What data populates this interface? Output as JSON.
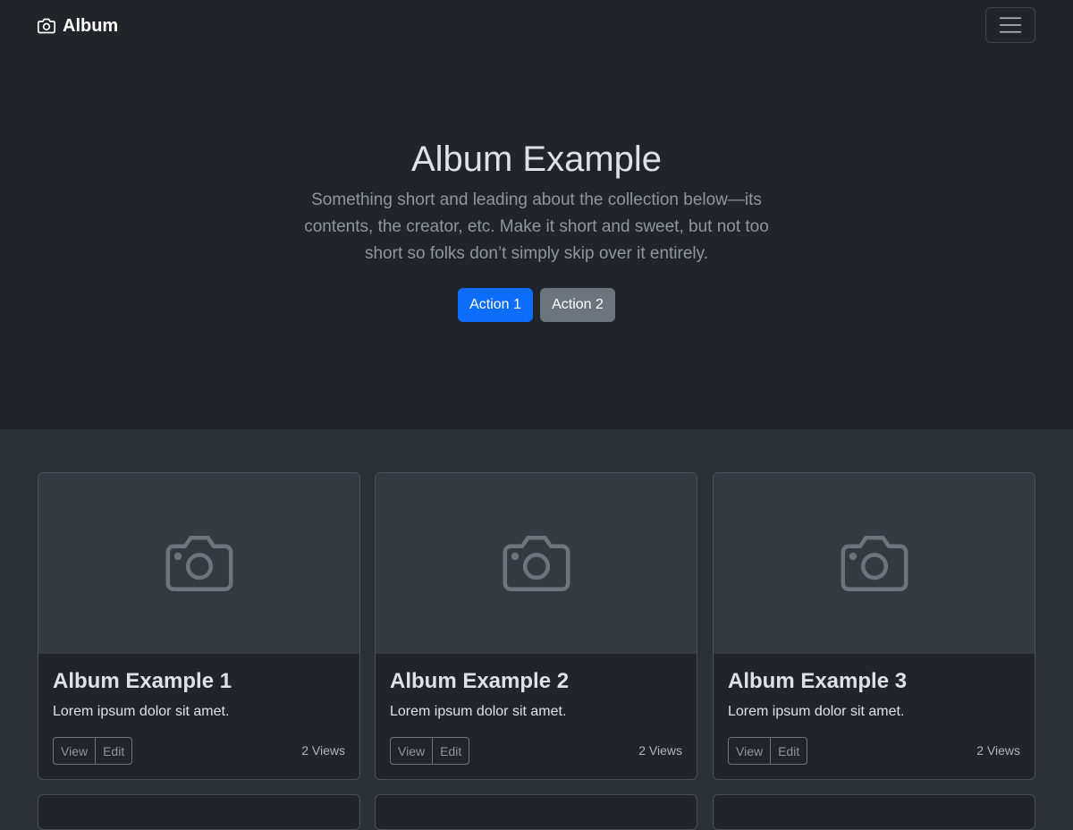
{
  "navbar": {
    "brand_label": "Album",
    "brand_icon": "camera-icon",
    "toggler_icon": "hamburger-menu-icon"
  },
  "hero": {
    "title": "Album Example",
    "lead": "Something short and leading about the collection below—its contents, the creator, etc. Make it short and sweet, but not too short so folks don’t simply skip over it entirely.",
    "primary_button": "Action 1",
    "secondary_button": "Action 2"
  },
  "cards": [
    {
      "title": "Album Example 1",
      "text": "Lorem ipsum dolor sit amet.",
      "view_label": "View",
      "edit_label": "Edit",
      "views": "2 Views"
    },
    {
      "title": "Album Example 2",
      "text": "Lorem ipsum dolor sit amet.",
      "view_label": "View",
      "edit_label": "Edit",
      "views": "2 Views"
    },
    {
      "title": "Album Example 3",
      "text": "Lorem ipsum dolor sit amet.",
      "view_label": "View",
      "edit_label": "Edit",
      "views": "2 Views"
    }
  ],
  "colors": {
    "navbar_bg": "#212529",
    "page_bg": "#2b3035",
    "primary": "#0d6efd",
    "secondary": "#6c757d"
  }
}
